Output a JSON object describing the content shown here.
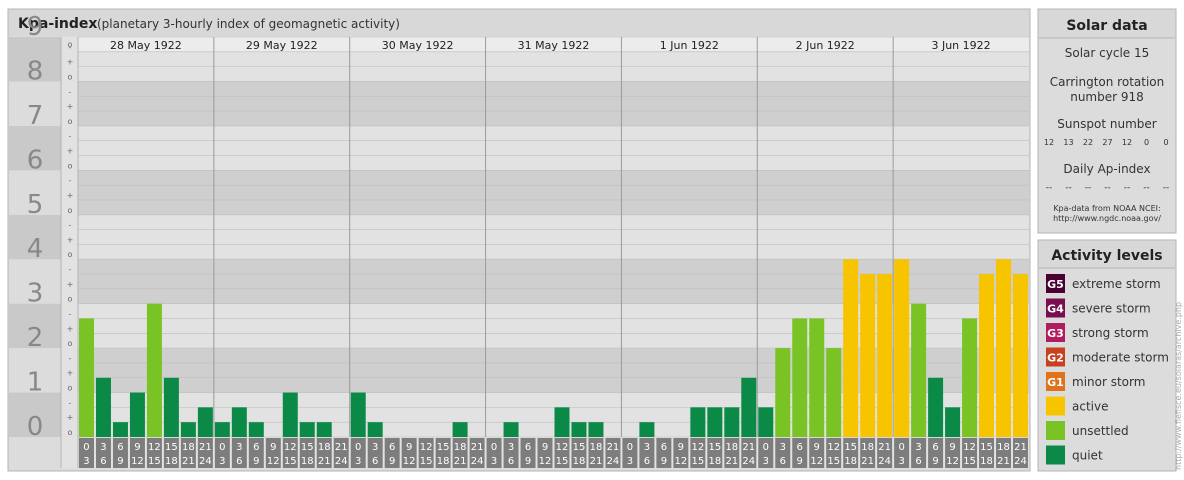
{
  "header": {
    "title": "Kpa-index",
    "subtitle": "(planetary 3-hourly index of geomagnetic activity)"
  },
  "chart_data": {
    "type": "bar",
    "ylim": [
      0,
      9
    ],
    "y_ticks": [
      "0",
      "1",
      "2",
      "3",
      "4",
      "5",
      "6",
      "7",
      "8",
      "9"
    ],
    "sub_ticks": [
      "o",
      "+",
      "-"
    ],
    "days": [
      "28 May 1922",
      "29 May 1922",
      "30 May 1922",
      "31 May 1922",
      "1 Jun 1922",
      "2 Jun 1922",
      "3 Jun 1922"
    ],
    "hour_starts": [
      "0",
      "3",
      "6",
      "9",
      "12",
      "15",
      "18",
      "21"
    ],
    "hour_ends": [
      "3",
      "6",
      "9",
      "12",
      "15",
      "18",
      "21",
      "24"
    ],
    "values": [
      [
        2.667,
        1.333,
        0.333,
        1.0,
        3.0,
        1.333,
        0.333,
        0.667
      ],
      [
        0.333,
        0.667,
        0.333,
        0.0,
        1.0,
        0.333,
        0.333,
        0.0
      ],
      [
        1.0,
        0.333,
        0.0,
        0.0,
        0.0,
        0.0,
        0.333,
        0.0
      ],
      [
        0.0,
        0.333,
        0.0,
        0.0,
        0.667,
        0.333,
        0.333,
        0.0
      ],
      [
        0.0,
        0.333,
        0.0,
        0.0,
        0.667,
        0.667,
        0.667,
        1.333
      ],
      [
        0.667,
        2.0,
        2.667,
        2.667,
        2.0,
        4.0,
        3.667,
        3.667
      ],
      [
        4.0,
        3.0,
        1.333,
        0.667,
        2.667,
        3.667,
        4.0,
        3.667
      ]
    ],
    "colors": {
      "quiet": "#0a8a46",
      "unsettled": "#7ac324",
      "active": "#f7c400",
      "minor": "#e0721c",
      "moderate": "#c9401e",
      "strong": "#b01c5e",
      "severe": "#7a0d4d",
      "extreme": "#4a0030"
    }
  },
  "solar": {
    "title": "Solar data",
    "cycle": "Solar cycle 15",
    "carrington_line1": "Carrington rotation",
    "carrington_line2": "number 918",
    "sunspot_label": "Sunspot number",
    "sunspot_values": [
      "12",
      "13",
      "22",
      "27",
      "12",
      "0",
      "0"
    ],
    "ap_label": "Daily Ap-index",
    "ap_values": [
      "--",
      "--",
      "--",
      "--",
      "--",
      "--",
      "--"
    ],
    "source_line1": "Kpa-data from NOAA NCEI:",
    "source_line2": "http://www.ngdc.noaa.gov/"
  },
  "activity": {
    "title": "Activity levels",
    "items": [
      {
        "badge": "G5",
        "label": "extreme storm",
        "color": "#4a0030"
      },
      {
        "badge": "G4",
        "label": "severe storm",
        "color": "#7a0d4d"
      },
      {
        "badge": "G3",
        "label": "strong storm",
        "color": "#b01c5e"
      },
      {
        "badge": "G2",
        "label": "moderate storm",
        "color": "#c9401e"
      },
      {
        "badge": "G1",
        "label": "minor storm",
        "color": "#e0721c"
      },
      {
        "badge": "",
        "label": "active",
        "color": "#f7c400"
      },
      {
        "badge": "",
        "label": "unsettled",
        "color": "#7ac324"
      },
      {
        "badge": "",
        "label": "quiet",
        "color": "#0a8a46"
      }
    ]
  },
  "credit": "http://www.fiefisce.eu/solaras/archive.php"
}
